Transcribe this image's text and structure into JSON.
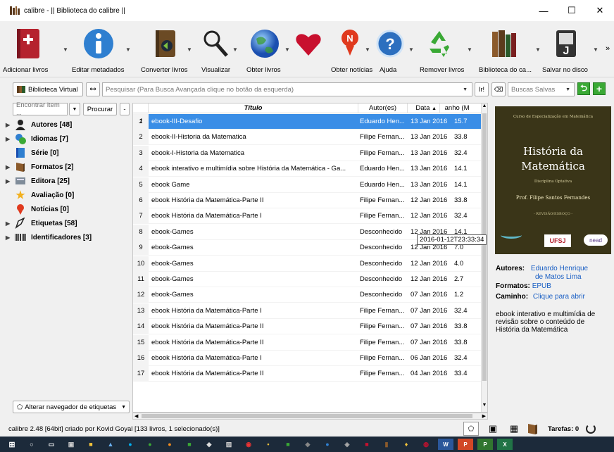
{
  "window": {
    "title": "calibre - || Biblioteca do calibre ||",
    "minimize": "—",
    "maximize": "☐",
    "close": "✕"
  },
  "toolbar": {
    "add_books": "Adicionar livros",
    "edit_metadata": "Editar metadados",
    "convert_books": "Converter livros",
    "view": "Visualizar",
    "get_books": "Obter livros",
    "fetch_news": "Obter notícias",
    "help": "Ajuda",
    "remove_books": "Remover livros",
    "library": "Biblioteca do ca...",
    "save_to_disk": "Salvar no disco",
    "more": "»"
  },
  "searchbar": {
    "virtual_library": "Biblioteca Virtual",
    "search_placeholder": "Pesquisar (Para Busca Avançada clique no botão da esquerda)",
    "saved_searches_placeholder": "Buscas Salvas"
  },
  "tag_browser": {
    "find_placeholder": "Encontrar item ...",
    "find_button": "Procurar",
    "collapse": "-",
    "items": [
      {
        "label": "Autores [48]",
        "expandable": true,
        "icon": "user-icon"
      },
      {
        "label": "Idiomas [7]",
        "expandable": true,
        "icon": "languages-icon"
      },
      {
        "label": "Série [0]",
        "expandable": false,
        "icon": "series-icon"
      },
      {
        "label": "Formatos [2]",
        "expandable": true,
        "icon": "book-icon"
      },
      {
        "label": "Editora [25]",
        "expandable": true,
        "icon": "publisher-icon"
      },
      {
        "label": "Avaliação [0]",
        "expandable": false,
        "icon": "star-icon"
      },
      {
        "label": "Notícias [0]",
        "expandable": false,
        "icon": "news-icon"
      },
      {
        "label": "Etiquetas [58]",
        "expandable": true,
        "icon": "tag-icon"
      },
      {
        "label": "Identificadores [3]",
        "expandable": true,
        "icon": "barcode-icon"
      }
    ],
    "alter_button": "Alterar navegador de etiquetas"
  },
  "table": {
    "headers": {
      "title": "Título",
      "authors": "Autor(es)",
      "date": "Data",
      "size": " anho (M"
    },
    "rows": [
      {
        "n": "1",
        "title": "ebook-III-Desafio",
        "author": "Eduardo Hen...",
        "date": "13 Jan 2016",
        "size": "15.7"
      },
      {
        "n": "2",
        "title": "ebook-II-Historia da Matematica",
        "author": "Filipe Fernan...",
        "date": "13 Jan 2016",
        "size": "33.8"
      },
      {
        "n": "3",
        "title": "ebook-I-Historia da Matematica",
        "author": "Filipe Fernan...",
        "date": "13 Jan 2016",
        "size": "32.4"
      },
      {
        "n": "4",
        "title": "ebook interativo e multimídia sobre História da Matemática - Ga...",
        "author": "Eduardo Hen...",
        "date": "13 Jan 2016",
        "size": "14.1"
      },
      {
        "n": "5",
        "title": "ebook Game",
        "author": "Eduardo Hen...",
        "date": "13 Jan 2016",
        "size": "14.1"
      },
      {
        "n": "6",
        "title": "ebook História da Matemática-Parte II",
        "author": "Filipe Fernan...",
        "date": "12 Jan 2016",
        "size": "33.8"
      },
      {
        "n": "7",
        "title": "ebook História da Matemática-Parte I",
        "author": "Filipe Fernan...",
        "date": "12 Jan 2016",
        "size": "32.4"
      },
      {
        "n": "8",
        "title": "ebook-Games",
        "author": "Desconhecido",
        "date": "12 Jan 2016",
        "size": "14.1"
      },
      {
        "n": "9",
        "title": "ebook-Games",
        "author": "Desconhecido",
        "date": "12 Jan 2016",
        "size": "7.0"
      },
      {
        "n": "10",
        "title": "ebook-Games",
        "author": "Desconhecido",
        "date": "12 Jan 2016",
        "size": "4.0"
      },
      {
        "n": "11",
        "title": "ebook-Games",
        "author": "Desconhecido",
        "date": "12 Jan 2016",
        "size": "2.7"
      },
      {
        "n": "12",
        "title": "ebook-Games",
        "author": "Desconhecido",
        "date": "07 Jan 2016",
        "size": "1.2"
      },
      {
        "n": "13",
        "title": "ebook História da Matemática-Parte I",
        "author": "Filipe Fernan...",
        "date": "07 Jan 2016",
        "size": "32.4"
      },
      {
        "n": "14",
        "title": "ebook História da Matemática-Parte II",
        "author": "Filipe Fernan...",
        "date": "07 Jan 2016",
        "size": "33.8"
      },
      {
        "n": "15",
        "title": "ebook História da Matemática-Parte II",
        "author": "Filipe Fernan...",
        "date": "07 Jan 2016",
        "size": "33.8"
      },
      {
        "n": "16",
        "title": "ebook História da Matemática-Parte I",
        "author": "Filipe Fernan...",
        "date": "06 Jan 2016",
        "size": "32.4"
      },
      {
        "n": "17",
        "title": "ebook História da Matemática-Parte II",
        "author": "Filipe Fernan...",
        "date": "04 Jan 2016",
        "size": "33.4"
      }
    ],
    "tooltip": "2016-01-12T23:33:34"
  },
  "cover": {
    "course": "Curso de Especialização em Matemática",
    "title_line1": "História da",
    "title_line2": "Matemática",
    "discipline": "Disciplina Optativa",
    "author": "Prof. Filipe Santos Fernandes",
    "edition": "- REVISÃO/ESBOÇO -",
    "ufsj": "UFSJ",
    "nead": "nead"
  },
  "details": {
    "authors_label": "Autores:",
    "authors_value_1": "Eduardo Henrique",
    "authors_value_2": "de Matos Lima",
    "formats_label": "Formatos:",
    "formats_value": "EPUB",
    "path_label": "Caminho:",
    "path_value": "Clique para abrir",
    "desc_1": "ebook interativo e multimídia de",
    "desc_2": "revisão sobre o conteúdo de",
    "desc_3": "História da Matemática"
  },
  "status": {
    "text": "calibre 2.48 [64bit] criado por Kovid Goyal   [133 livros, 1 selecionado(s)]",
    "jobs": "Tarefas: 0"
  },
  "colors": {
    "selection": "#3a8ee6",
    "link": "#1a5fc4",
    "cover_bg": "#3a3518"
  }
}
